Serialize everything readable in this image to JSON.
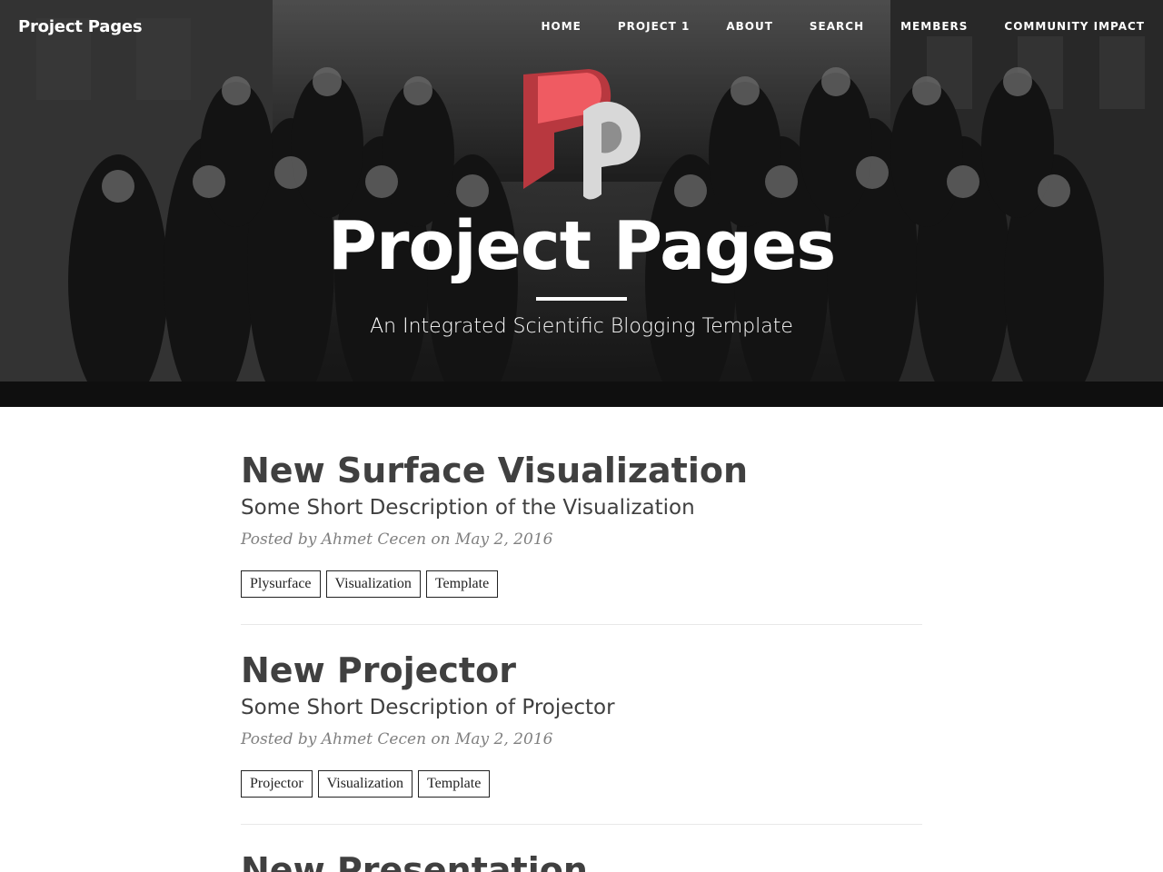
{
  "navbar": {
    "brand": "Project Pages",
    "links": [
      "HOME",
      "PROJECT 1",
      "ABOUT",
      "SEARCH",
      "MEMBERS",
      "COMMUNITY IMPACT"
    ]
  },
  "header": {
    "title": "Project Pages",
    "subtitle": "An Integrated Scientific Blogging Template",
    "logo_icon": "project-pages-logo-icon"
  },
  "posts": [
    {
      "title": "New Surface Visualization",
      "subtitle": "Some Short Description of the Visualization",
      "meta": "Posted by Ahmet Cecen on May 2, 2016",
      "tags": [
        "Plysurface",
        "Visualization",
        "Template"
      ]
    },
    {
      "title": "New Projector",
      "subtitle": "Some Short Description of Projector",
      "meta": "Posted by Ahmet Cecen on May 2, 2016",
      "tags": [
        "Projector",
        "Visualization",
        "Template"
      ]
    },
    {
      "title": "New Presentation"
    }
  ],
  "colors": {
    "logo_red": "#e0505a",
    "logo_gray": "#c8c8c8",
    "text": "#404040",
    "meta": "#808080"
  }
}
